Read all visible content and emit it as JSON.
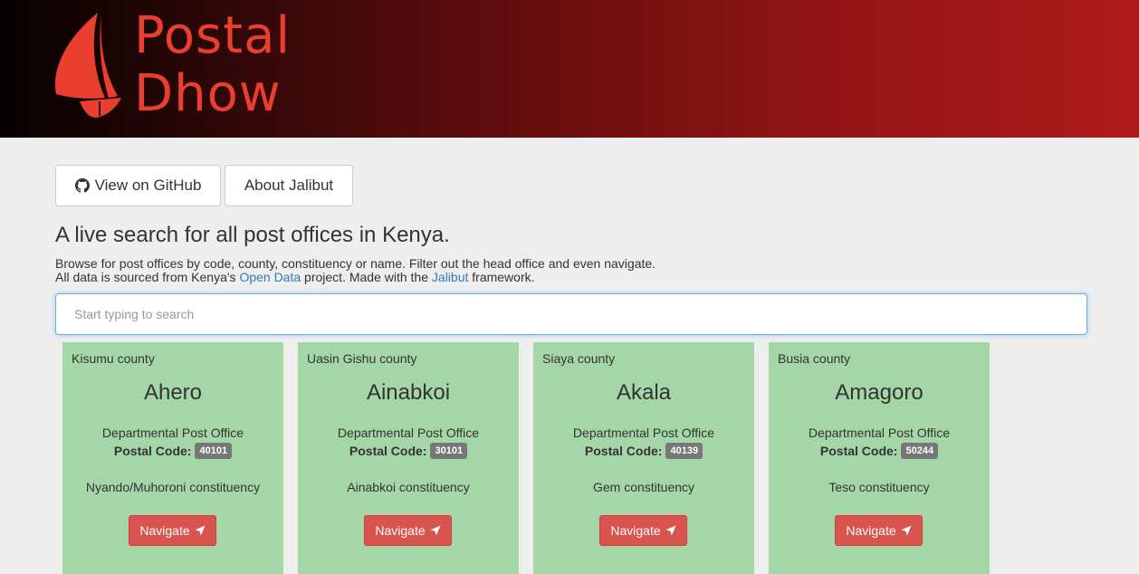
{
  "brand": {
    "line1": "Postal",
    "line2": "Dhow"
  },
  "buttons": {
    "github": "View on GitHub",
    "about": "About Jalibut"
  },
  "tagline": "A live search for all post offices in Kenya.",
  "description": {
    "line1": "Browse for post offices by code, county, constituency or name. Filter out the head office and even navigate.",
    "line2_pre": "All data is sourced from Kenya's ",
    "link1": "Open Data",
    "line2_mid": " project. Made with the ",
    "link2": "Jalibut",
    "line2_post": " framework."
  },
  "search": {
    "placeholder": "Start typing to search",
    "value": ""
  },
  "cards": [
    {
      "county": "Kisumu county",
      "name": "Ahero",
      "office_type": "Departmental Post Office",
      "postal_label": "Postal Code:",
      "postal_code": "40101",
      "constituency": "Nyando/Muhoroni constituency",
      "navigate": "Navigate"
    },
    {
      "county": "Uasin Gishu county",
      "name": "Ainabkoi",
      "office_type": "Departmental Post Office",
      "postal_label": "Postal Code:",
      "postal_code": "30101",
      "constituency": "Ainabkoi constituency",
      "navigate": "Navigate"
    },
    {
      "county": "Siaya county",
      "name": "Akala",
      "office_type": "Departmental Post Office",
      "postal_label": "Postal Code:",
      "postal_code": "40139",
      "constituency": "Gem constituency",
      "navigate": "Navigate"
    },
    {
      "county": "Busia county",
      "name": "Amagoro",
      "office_type": "Departmental Post Office",
      "postal_label": "Postal Code:",
      "postal_code": "50244",
      "constituency": "Teso constituency",
      "navigate": "Navigate"
    }
  ],
  "colors": {
    "brand": "#ea3f2f",
    "card_bg": "#a5d6a7",
    "navigate_btn": "#d9534f",
    "link": "#337ab7",
    "badge": "#777777"
  },
  "icons": {
    "github": "github-icon",
    "navigate": "location-arrow-icon",
    "logo": "dhow-sail-icon"
  }
}
